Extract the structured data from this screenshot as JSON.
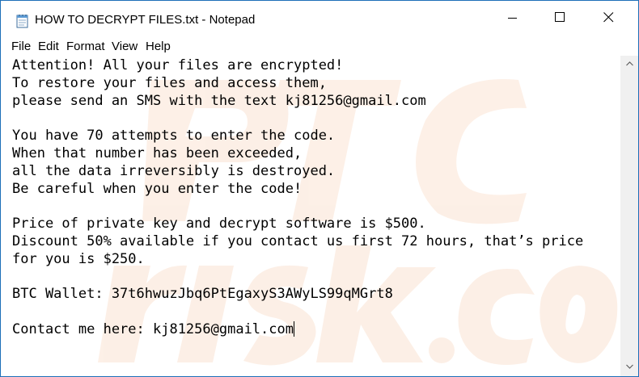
{
  "window": {
    "title": "HOW TO DECRYPT FILES.txt - Notepad",
    "icon": "notepad-icon",
    "controls": {
      "minimize_icon": "minimize-icon",
      "maximize_icon": "maximize-icon",
      "close_icon": "close-icon"
    }
  },
  "menu": {
    "items": [
      "File",
      "Edit",
      "Format",
      "View",
      "Help"
    ]
  },
  "document": {
    "lines": [
      "Attention! All your files are encrypted!",
      "To restore your files and access them,",
      "please send an SMS with the text kj81256@gmail.com",
      "",
      "You have 70 attempts to enter the code.",
      "When that number has been exceeded,",
      "all the data irreversibly is destroyed.",
      "Be careful when you enter the code!",
      "",
      "Price of private key and decrypt software is $500.",
      "Discount 50% available if you contact us first 72 hours, that’s price",
      "for you is $250.",
      "",
      "BTC Wallet: 37t6hwuzJbq6PtEgaxyS3AWyLS99qMGrt8",
      "",
      "Contact me here: kj81256@gmail.com"
    ]
  },
  "scrollbar": {
    "up_icon": "scroll-up-arrow-icon",
    "down_icon": "scroll-down-arrow-icon"
  },
  "colors": {
    "window_border": "#1d6fb8",
    "background": "#ffffff",
    "text": "#000000",
    "scrollbar": "#f0f0f0",
    "watermark": "#fbe3d3"
  }
}
